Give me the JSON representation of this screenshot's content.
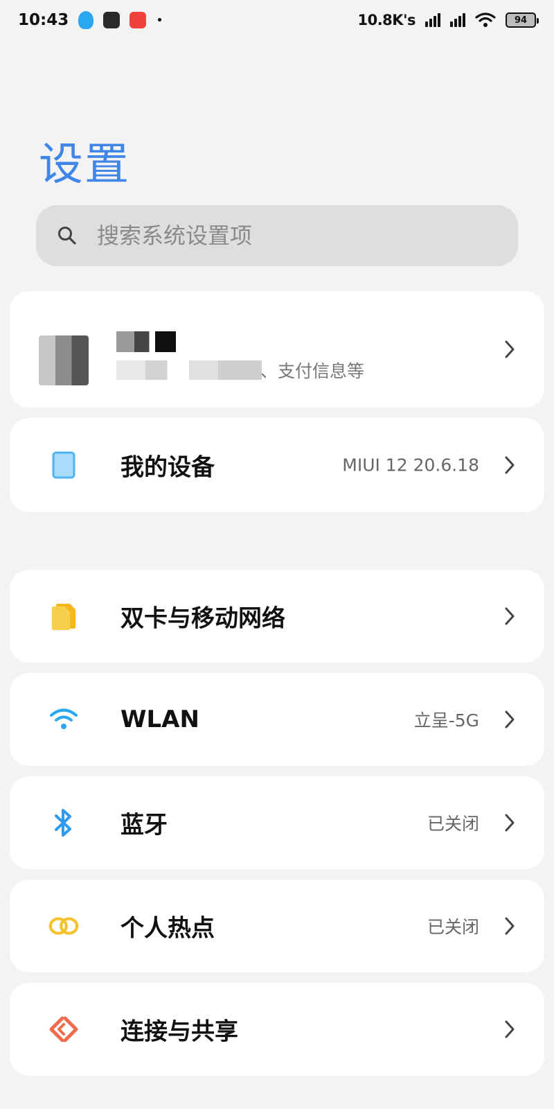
{
  "status_bar": {
    "time": "10:43",
    "speed": "10.8K's",
    "battery": "94"
  },
  "page": {
    "title": "设置"
  },
  "search": {
    "placeholder": "搜索系统设置项"
  },
  "account": {
    "subtitle": "、支付信息等"
  },
  "settings": [
    {
      "key": "my_device",
      "label": "我的设备",
      "value": "MIUI 12 20.6.18",
      "icon": "tablet-icon",
      "icon_color": "#4fb3f0"
    },
    {
      "key": "dual_sim",
      "label": "双卡与移动网络",
      "value": "",
      "icon": "sim-card-icon",
      "icon_color": "#f5c332"
    },
    {
      "key": "wlan",
      "label": "WLAN",
      "value": "立呈-5G",
      "icon": "wifi-icon",
      "icon_color": "#29a7f0"
    },
    {
      "key": "bluetooth",
      "label": "蓝牙",
      "value": "已关闭",
      "icon": "bluetooth-icon",
      "icon_color": "#2f9bf0"
    },
    {
      "key": "hotspot",
      "label": "个人热点",
      "value": "已关闭",
      "icon": "hotspot-icon",
      "icon_color": "#f5c332"
    },
    {
      "key": "connection_sharing",
      "label": "连接与共享",
      "value": "",
      "icon": "share-icon",
      "icon_color": "#f06a4c"
    }
  ]
}
